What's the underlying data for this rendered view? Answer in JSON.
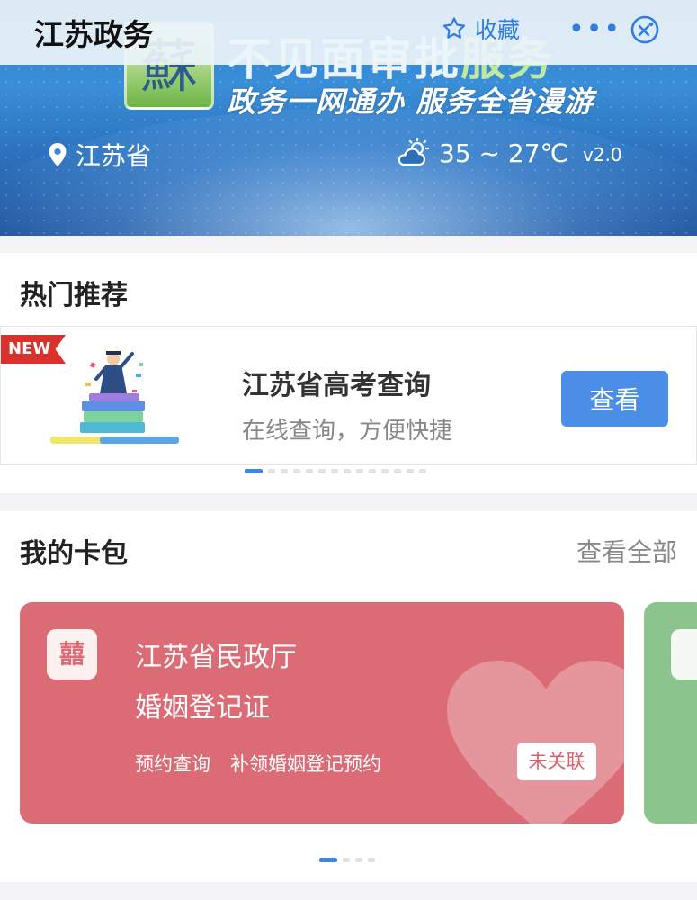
{
  "navbar": {
    "title": "江苏政务",
    "favorite_label": "收藏",
    "more_icon": "more-icon",
    "close_icon": "close-icon"
  },
  "banner": {
    "logo_char": "蘇",
    "slogan_main": "不见面审批",
    "slogan_highlight": "服务",
    "slogan_sub": "政务一网通办 服务全省漫游",
    "location": "江苏省",
    "temperature": "35 ~ 27℃",
    "version": "v2.0"
  },
  "hot": {
    "title": "热门推荐",
    "badge": "NEW",
    "item_title": "江苏省高考查询",
    "item_subtitle": "在线查询，方便快捷",
    "button_label": "查看",
    "pager": {
      "count": 14,
      "active": 0
    }
  },
  "wallet": {
    "title": "我的卡包",
    "view_all": "查看全部",
    "card": {
      "icon_char": "囍",
      "issuer": "江苏省民政厅",
      "name": "婚姻登记证",
      "link1": "预约查询",
      "link2": "补领婚姻登记预约",
      "status": "未关联"
    },
    "pager": {
      "count": 4,
      "active": 0
    }
  },
  "colors": {
    "accent_blue": "#4a8ee8",
    "card_red": "#db6c76",
    "card_green": "#8cc48e",
    "badge_red": "#d9322e"
  }
}
